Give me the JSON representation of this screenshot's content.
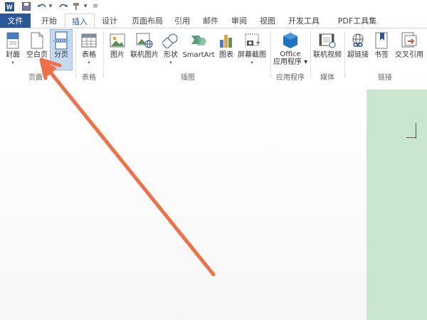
{
  "quick_access": {
    "app_icon": "word-logo-icon",
    "items": [
      "save-icon",
      "undo-icon",
      "redo-icon",
      "format-painter-icon",
      "customize-qat-icon"
    ]
  },
  "tabs": [
    {
      "label": "文件"
    },
    {
      "label": "开始"
    },
    {
      "label": "插入"
    },
    {
      "label": "设计"
    },
    {
      "label": "页面布局"
    },
    {
      "label": "引用"
    },
    {
      "label": "邮件"
    },
    {
      "label": "审阅"
    },
    {
      "label": "视图"
    },
    {
      "label": "开发工具"
    },
    {
      "label": "PDF工具集"
    }
  ],
  "active_tab": "插入",
  "ribbon": {
    "groups": {
      "pages": {
        "label": "页面",
        "buttons": [
          "封面",
          "空白页",
          "分页"
        ]
      },
      "table": {
        "label": "表格",
        "buttons": [
          "表格"
        ]
      },
      "illustrations": {
        "label": "插图",
        "buttons": [
          "图片",
          "联机图片",
          "形状",
          "SmartArt",
          "图表",
          "屏幕截图"
        ]
      },
      "apps": {
        "label": "应用程序",
        "buttons": [
          "Office",
          "应用程序"
        ]
      },
      "media": {
        "label": "媒体",
        "buttons": [
          "联机视频"
        ]
      },
      "links": {
        "label": "链接",
        "buttons": [
          "超链接",
          "书签",
          "交叉引用"
        ]
      }
    }
  },
  "colors": {
    "file_tab": "#2b579a",
    "page_background": "#cbe6ce",
    "annotation_arrow": "#f07048"
  }
}
